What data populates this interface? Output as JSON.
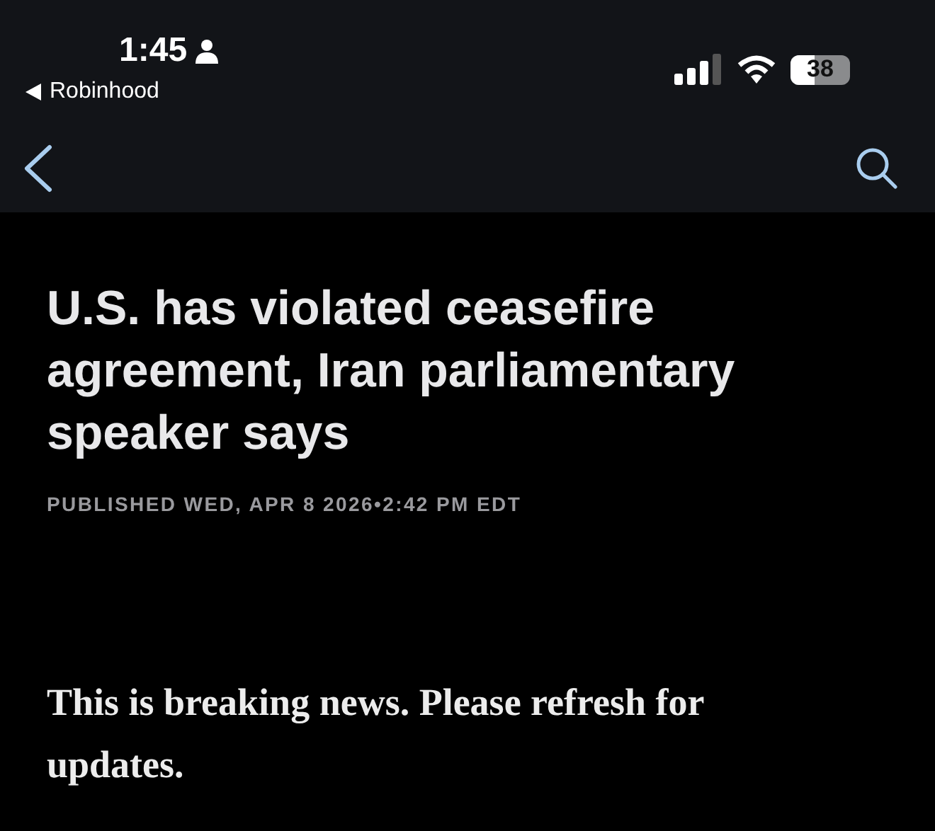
{
  "status_bar": {
    "time": "1:45",
    "back_app": "Robinhood",
    "battery": "38"
  },
  "article": {
    "headline": "U.S. has violated ceasefire agreement, Iran parliamentary speaker says",
    "published": "PUBLISHED WED, APR 8 2026",
    "separator": "•",
    "time": "2:42 PM EDT",
    "body": "This is breaking news. Please refresh for updates."
  }
}
